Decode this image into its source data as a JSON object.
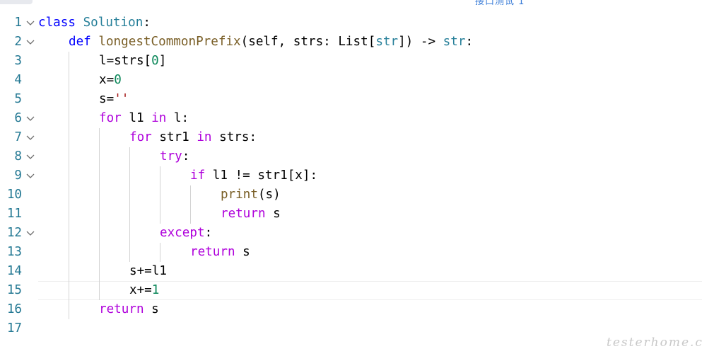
{
  "tab": {
    "partial_title": "接口测试 1"
  },
  "editor": {
    "lines": [
      {
        "num": "1",
        "fold": true,
        "current": false,
        "indent": 0,
        "tokens": [
          [
            "kw",
            "class"
          ],
          [
            "txt",
            " "
          ],
          [
            "cl",
            "Solution"
          ],
          [
            "txt",
            ":"
          ]
        ]
      },
      {
        "num": "2",
        "fold": true,
        "current": false,
        "indent": 1,
        "tokens": [
          [
            "kw",
            "def"
          ],
          [
            "txt",
            " "
          ],
          [
            "fn",
            "longestCommonPrefix"
          ],
          [
            "txt",
            "(self, strs: List["
          ],
          [
            "cl",
            "str"
          ],
          [
            "txt",
            "]) -> "
          ],
          [
            "cl",
            "str"
          ],
          [
            "txt",
            ":"
          ]
        ]
      },
      {
        "num": "3",
        "fold": false,
        "current": false,
        "indent": 2,
        "tokens": [
          [
            "txt",
            "l=strs["
          ],
          [
            "num",
            "0"
          ],
          [
            "txt",
            "]"
          ]
        ]
      },
      {
        "num": "4",
        "fold": false,
        "current": false,
        "indent": 2,
        "tokens": [
          [
            "txt",
            "x="
          ],
          [
            "num",
            "0"
          ]
        ]
      },
      {
        "num": "5",
        "fold": false,
        "current": false,
        "indent": 2,
        "tokens": [
          [
            "txt",
            "s="
          ],
          [
            "str",
            "''"
          ]
        ]
      },
      {
        "num": "6",
        "fold": true,
        "current": false,
        "indent": 2,
        "tokens": [
          [
            "ctl",
            "for"
          ],
          [
            "txt",
            " l1 "
          ],
          [
            "ctl",
            "in"
          ],
          [
            "txt",
            " l:"
          ]
        ]
      },
      {
        "num": "7",
        "fold": true,
        "current": false,
        "indent": 3,
        "tokens": [
          [
            "ctl",
            "for"
          ],
          [
            "txt",
            " str1 "
          ],
          [
            "ctl",
            "in"
          ],
          [
            "txt",
            " strs:"
          ]
        ]
      },
      {
        "num": "8",
        "fold": true,
        "current": false,
        "indent": 4,
        "tokens": [
          [
            "ctl",
            "try"
          ],
          [
            "txt",
            ":"
          ]
        ]
      },
      {
        "num": "9",
        "fold": true,
        "current": false,
        "indent": 5,
        "tokens": [
          [
            "ctl",
            "if"
          ],
          [
            "txt",
            " l1 != str1[x]:"
          ]
        ]
      },
      {
        "num": "10",
        "fold": false,
        "current": false,
        "indent": 6,
        "tokens": [
          [
            "fn",
            "print"
          ],
          [
            "txt",
            "(s)"
          ]
        ]
      },
      {
        "num": "11",
        "fold": false,
        "current": false,
        "indent": 6,
        "tokens": [
          [
            "ctl",
            "return"
          ],
          [
            "txt",
            " s"
          ]
        ]
      },
      {
        "num": "12",
        "fold": true,
        "current": false,
        "indent": 4,
        "tokens": [
          [
            "ctl",
            "except"
          ],
          [
            "txt",
            ":"
          ]
        ]
      },
      {
        "num": "13",
        "fold": false,
        "current": false,
        "indent": 5,
        "tokens": [
          [
            "ctl",
            "return"
          ],
          [
            "txt",
            " s"
          ]
        ]
      },
      {
        "num": "14",
        "fold": false,
        "current": false,
        "indent": 3,
        "tokens": [
          [
            "txt",
            "s+=l1"
          ]
        ]
      },
      {
        "num": "15",
        "fold": false,
        "current": true,
        "indent": 3,
        "tokens": [
          [
            "txt",
            "x+="
          ],
          [
            "num",
            "1"
          ]
        ]
      },
      {
        "num": "16",
        "fold": false,
        "current": false,
        "indent": 2,
        "tokens": [
          [
            "ctl",
            "return"
          ],
          [
            "txt",
            " s"
          ]
        ]
      },
      {
        "num": "17",
        "fold": false,
        "current": false,
        "indent": 0,
        "tokens": []
      }
    ]
  },
  "watermark": "testerhome.com",
  "colors": {
    "line_number": "#237893",
    "keyword": "#0000ff",
    "class_type": "#267f99",
    "function": "#795e26",
    "control": "#af00db",
    "number": "#098658",
    "string": "#a31515",
    "text": "#000000",
    "indent_guide": "#d3d3d3",
    "current_line_border": "#eeeeee"
  },
  "icons": {
    "fold": "chevron-down-icon"
  }
}
